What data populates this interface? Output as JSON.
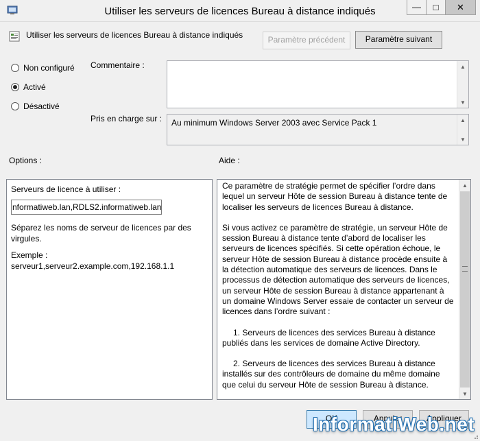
{
  "window": {
    "title": "Utiliser les serveurs de licences Bureau à distance indiqués",
    "minimize": "—",
    "maximize": "□",
    "close": "✕"
  },
  "header": {
    "policy_name": "Utiliser les serveurs de licences Bureau à distance indiqués",
    "prev_label": "Paramètre précédent",
    "next_label": "Paramètre suivant"
  },
  "state": {
    "options": [
      {
        "label": "Non configuré",
        "checked": false
      },
      {
        "label": "Activé",
        "checked": true
      },
      {
        "label": "Désactivé",
        "checked": false
      }
    ]
  },
  "comment": {
    "label": "Commentaire :",
    "value": ""
  },
  "supported": {
    "label": "Pris en charge sur :",
    "value": "Au minimum Windows Server 2003 avec Service Pack 1"
  },
  "options": {
    "heading": "Options :",
    "servers_label": "Serveurs de licence à utiliser :",
    "servers_value": "nformatiweb.lan,RDLS2.informatiweb.lan",
    "separate_note": "Séparez les noms de serveur de licences par des virgules.",
    "example_label": "Exemple :",
    "example_value": "serveur1,serveur2.example.com,192.168.1.1"
  },
  "help": {
    "heading": "Aide :",
    "paragraphs": [
      "Ce paramètre de stratégie permet de spécifier l’ordre dans lequel un serveur Hôte de session Bureau à distance tente de localiser les serveurs de licences Bureau à distance.",
      "Si vous activez ce paramètre de stratégie, un serveur Hôte de session Bureau à distance tente d’abord de localiser les serveurs de licences spécifiés. Si cette opération échoue, le serveur Hôte de session Bureau à distance procède ensuite à la détection automatique des serveurs de licences. Dans le processus de détection automatique des serveurs de licences, un serveur Hôte de session Bureau à distance appartenant à un domaine Windows Server essaie de contacter un serveur de licences dans l’ordre suivant :",
      "1. Serveurs de licences des services Bureau à distance publiés dans les services de domaine Active Directory.",
      "2. Serveurs de licences des services Bureau à distance installés sur des contrôleurs de domaine du même domaine que celui du serveur Hôte de session Bureau à distance."
    ]
  },
  "footer": {
    "ok_label": "OK",
    "cancel_label": "Annuler",
    "apply_label": "Appliquer"
  },
  "watermark": "InformatiWeb.net",
  "colors": {
    "ok_accent": "#cde8ff",
    "watermark_outline": "#1f6fb2"
  }
}
